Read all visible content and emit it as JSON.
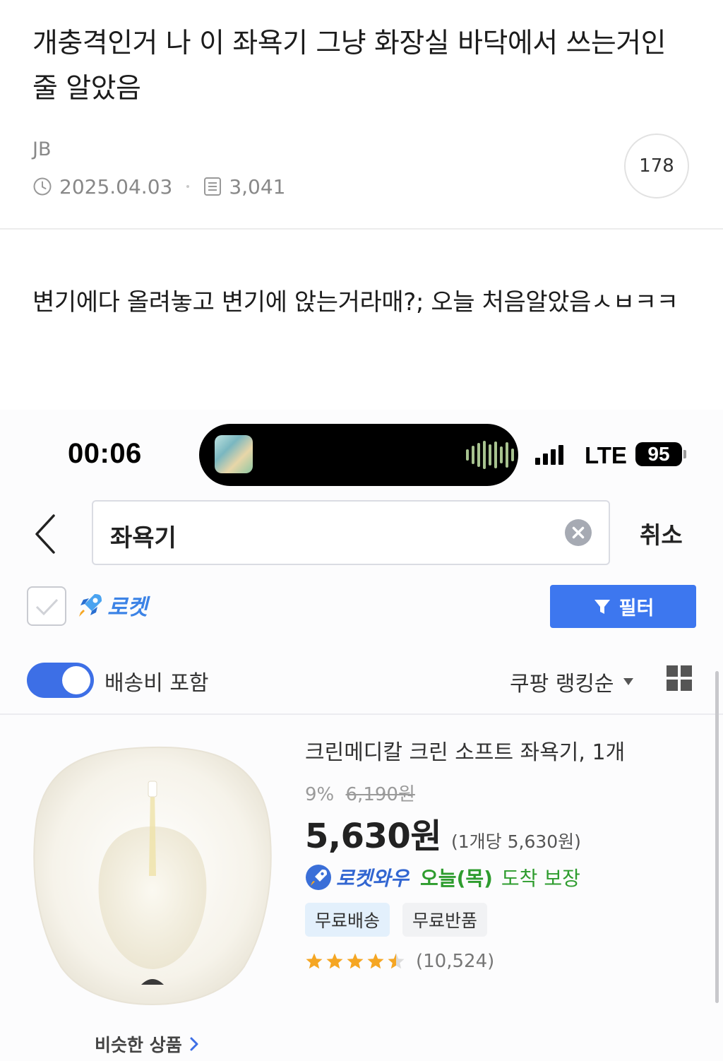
{
  "post": {
    "title": "개충격인거 나 이 좌욕기 그냥 화장실 바닥에서 쓰는거인 줄 알았음",
    "author": "JB",
    "date": "2025.04.03",
    "views": "3,041",
    "comment_count": "178",
    "body": "변기에다 올려놓고 변기에 앉는거라매?; 오늘 처음알았음ㅅㅂㅋㅋ"
  },
  "status_bar": {
    "time": "00:06",
    "network": "LTE",
    "battery": "95"
  },
  "search": {
    "query": "좌욕기",
    "cancel_label": "취소"
  },
  "filters": {
    "rocket_label": "로켓",
    "filter_label": "필터",
    "shipping_toggle_label": "배송비 포함",
    "shipping_toggle_on": true,
    "sort_label": "쿠팡 랭킹순"
  },
  "product": {
    "title": "크린메디칼 크린 소프트 좌욕기, 1개",
    "discount": "9%",
    "original_price": "6,190원",
    "price": "5,630원",
    "unit_price": "(1개당 5,630원)",
    "delivery_badge": "로켓와우",
    "delivery_day": "오늘(목)",
    "delivery_note": "도착 보장",
    "tags": [
      "무료배송",
      "무료반품"
    ],
    "rating": 4.5,
    "review_count": "(10,524)",
    "similar_label": "비슷한 상품"
  },
  "colors": {
    "accent_blue": "#3d77ef",
    "green": "#2e9c2e",
    "star": "#f5a623"
  }
}
